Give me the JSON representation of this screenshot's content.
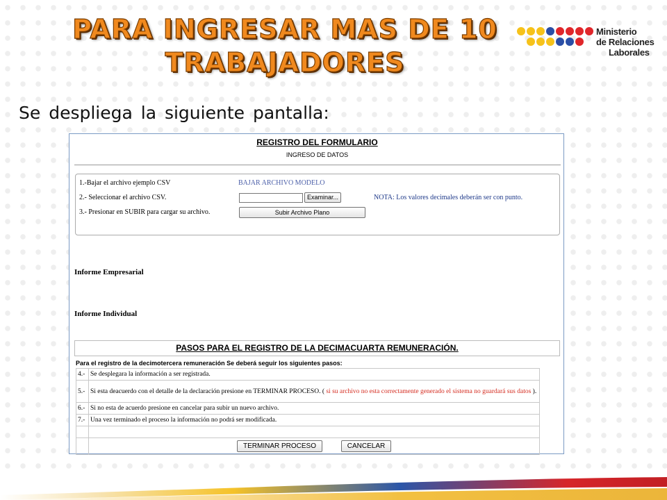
{
  "slide": {
    "title_line1": "PARA INGRESAR MAS DE 10",
    "title_line2": "TRABAJADORES",
    "subtitle": "Se despliega la siguiente pantalla:"
  },
  "logo": {
    "line1": "Ministerio",
    "line2": "de Relaciones",
    "line3": "Laborales"
  },
  "form": {
    "title": "REGISTRO  DEL FORMULARIO",
    "subtitle": "INGRESO DE DATOS",
    "step1": "1.-Bajar el archivo ejemplo CSV",
    "step1_link": "BAJAR ARCHIVO MODELO",
    "step2": "2.- Seleccionar el archivo CSV.",
    "browse_button": "Examinar...",
    "note": "NOTA: Los valores decimales deberán ser con punto.",
    "step3": "3.- Presionar en SUBIR para cargar su archivo.",
    "upload_button": "Subir Archivo Plano",
    "informe_empresarial": "Informe Empresarial",
    "informe_individual": "Informe Individual",
    "pasos_title": "PASOS PARA EL REGISTRO DE LA DECIMACUARTA REMUNERACIÓN.",
    "pasos_intro": "Para el registro de la decimotercera remuneración Se deberá seguir los siguientes pasos:",
    "steps": [
      {
        "num": "4.-",
        "text": "Se desplegara la información a ser registrada."
      },
      {
        "num": "5.-",
        "text": "Si esta deacuerdo con el detalle de la declaración presione en TERMINAR PROCESO. (",
        "red": "si su archivo no esta correctamente generado el sistema no guardará sus datos",
        "tail": ")."
      },
      {
        "num": "6.-",
        "text": "Si no esta de acuerdo presione en cancelar para subir un nuevo archivo."
      },
      {
        "num": "7.-",
        "text": "Una vez terminado el proceso la información no podrá ser modificada."
      }
    ],
    "finish_button": "TERMINAR PROCESO",
    "cancel_button": "CANCELAR"
  },
  "colors": {
    "title_orange": "#f0891e",
    "note_blue": "#1f3a8a",
    "warning_red": "#d42a1e"
  }
}
